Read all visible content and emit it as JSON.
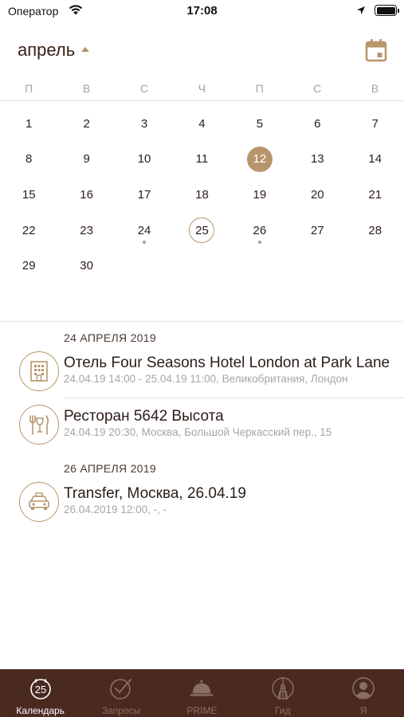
{
  "status_bar": {
    "carrier": "Оператор",
    "time": "17:08"
  },
  "header": {
    "month": "апрель",
    "calendar_icon": "calendar-icon"
  },
  "weekdays": [
    "П",
    "В",
    "С",
    "Ч",
    "П",
    "С",
    "В"
  ],
  "days": [
    {
      "n": "1"
    },
    {
      "n": "2"
    },
    {
      "n": "3"
    },
    {
      "n": "4"
    },
    {
      "n": "5"
    },
    {
      "n": "6"
    },
    {
      "n": "7"
    },
    {
      "n": "8"
    },
    {
      "n": "9"
    },
    {
      "n": "10"
    },
    {
      "n": "11"
    },
    {
      "n": "12",
      "state": "selected"
    },
    {
      "n": "13"
    },
    {
      "n": "14"
    },
    {
      "n": "15"
    },
    {
      "n": "16"
    },
    {
      "n": "17"
    },
    {
      "n": "18"
    },
    {
      "n": "19"
    },
    {
      "n": "20"
    },
    {
      "n": "21"
    },
    {
      "n": "22"
    },
    {
      "n": "23"
    },
    {
      "n": "24",
      "dot": true
    },
    {
      "n": "25",
      "state": "today"
    },
    {
      "n": "26",
      "dot": true
    },
    {
      "n": "27"
    },
    {
      "n": "28"
    },
    {
      "n": "29"
    },
    {
      "n": "30"
    }
  ],
  "events": {
    "group1_date": "24 АПРЕЛЯ 2019",
    "hotel": {
      "title": "Отель Four Seasons Hotel London at Park Lane",
      "subtitle": "24.04.19 14:00 - 25.04.19 11:00, Великобритания, Лондон",
      "icon": "hotel-icon"
    },
    "restaurant": {
      "title": "Ресторан 5642 Высота",
      "subtitle": "24.04.19 20:30, Москва, Большой Черкасский пер., 15",
      "icon": "restaurant-icon"
    },
    "group2_date": "26 АПРЕЛЯ 2019",
    "transfer": {
      "title": "Transfer, Москва, 26.04.19",
      "subtitle": "26.04.2019 12:00, -, -",
      "icon": "taxi-icon"
    }
  },
  "tabs": [
    {
      "label": "Календарь",
      "icon": "calendar-25-icon",
      "active": true
    },
    {
      "label": "Запросы",
      "icon": "check-circle-icon"
    },
    {
      "label": "PRIME",
      "icon": "service-bell-icon"
    },
    {
      "label": "Гид",
      "icon": "tower-icon"
    },
    {
      "label": "Я",
      "icon": "profile-icon"
    }
  ],
  "colors": {
    "accent": "#b8956a",
    "tab_bar": "#4a2a20",
    "text": "#2b1d18",
    "muted": "#aba4a0"
  }
}
